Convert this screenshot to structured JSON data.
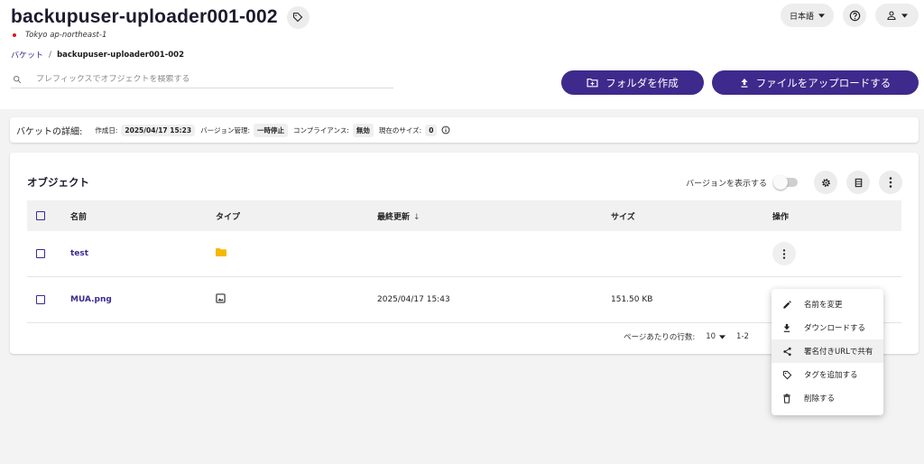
{
  "header": {
    "bucket_name": "backupuser-uploader001-002",
    "region": "Tokyo ap-northeast-1",
    "breadcrumb": {
      "root": "バケット",
      "separator": "/",
      "current": "backupuser-uploader001-002"
    },
    "search_placeholder": "プレフィックスでオブジェクトを検索する",
    "language": "日本語",
    "create_folder": "フォルダを作成",
    "upload_file": "ファイルをアップロードする"
  },
  "details": {
    "title": "バケットの詳細:",
    "created_label": "作成日:",
    "created_value": "2025/04/17 15:23",
    "versioning_label": "バージョン管理:",
    "versioning_value": "一時停止",
    "compliance_label": "コンプライアンス:",
    "compliance_value": "無効",
    "size_label": "現在のサイズ:",
    "size_value": "0"
  },
  "objects": {
    "title": "オブジェクト",
    "show_versions": "バージョンを表示する",
    "columns": {
      "name": "名前",
      "type": "タイプ",
      "modified": "最終更新",
      "size": "サイズ",
      "actions": "操作"
    },
    "rows": [
      {
        "name": "test",
        "type_icon": "folder-icon",
        "modified": "",
        "size": ""
      },
      {
        "name": "MUA.png",
        "type_icon": "image-icon",
        "modified": "2025/04/17 15:43",
        "size": "151.50 KB"
      }
    ],
    "rows_per_page_label": "ページあたりの行数:",
    "rows_per_page": "10",
    "range": "1-2"
  },
  "context_menu": {
    "items": [
      {
        "label": "名前を変更",
        "icon": "pencil-icon"
      },
      {
        "label": "ダウンロードする",
        "icon": "download-icon"
      },
      {
        "label": "署名付きURLで共有",
        "icon": "share-icon"
      },
      {
        "label": "タグを追加する",
        "icon": "tag-icon"
      },
      {
        "label": "削除する",
        "icon": "trash-icon"
      }
    ]
  },
  "colors": {
    "primary": "#3e2a8c",
    "folder": "#f5b800",
    "region_dot": "#d31b1b"
  }
}
